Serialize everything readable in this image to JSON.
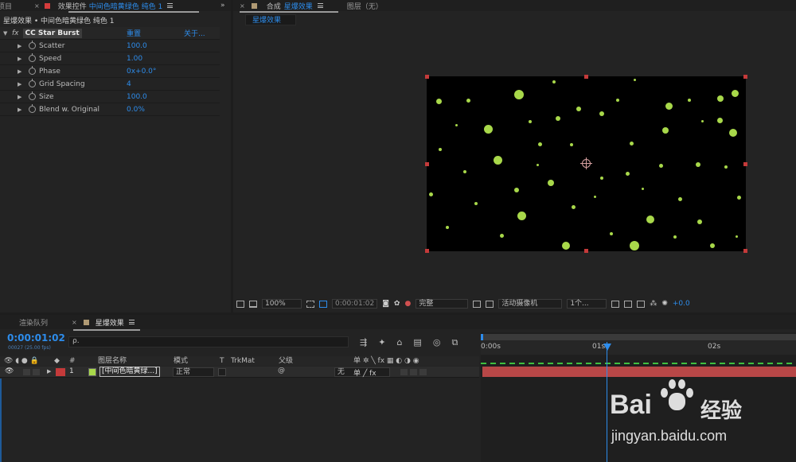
{
  "effect_panel": {
    "tab_project": "项目",
    "tab_prefix": "效果控件",
    "tab_title": "中间色暗黄绿色 纯色 1",
    "path": "星爆效果 • 中间色暗黄绿色 纯色 1",
    "effect_name": "CC Star Burst",
    "reset": "重置",
    "about": "关于...",
    "fx": "fx",
    "props": [
      {
        "name": "Scatter",
        "value": "100.0"
      },
      {
        "name": "Speed",
        "value": "1.00"
      },
      {
        "name": "Phase",
        "value": "0x+0.0°"
      },
      {
        "name": "Grid Spacing",
        "value": "4"
      },
      {
        "name": "Size",
        "value": "100.0"
      },
      {
        "name": "Blend w. Original",
        "value": "0.0%"
      }
    ]
  },
  "comp_panel": {
    "tab_prefix": "合成",
    "tab_name": "星爆效果",
    "layer_tab": "图层（无）",
    "sub_tab": "星爆效果",
    "toolbar": {
      "zoom": "100%",
      "timecode": "0:00:01:02",
      "quality": "完整",
      "camera": "活动摄像机",
      "views": "1个...",
      "exposure": "+0.0"
    }
  },
  "timeline": {
    "tab_render": "渲染队列",
    "tab_name": "星爆效果",
    "timecode": "0:00:01:02",
    "fps": "00027 (25.00 fps)",
    "search_placeholder": "ρ.",
    "col_hash": "#",
    "col_layer": "图层名称",
    "col_mode": "模式",
    "col_t": "T",
    "col_trkmat": "TrkMat",
    "col_parent": "父级",
    "layer": {
      "index": "1",
      "name": "[中间色暗黄绿...]",
      "mode": "正常",
      "parent": "无"
    },
    "ruler": [
      "0:00s",
      "01s",
      "02s"
    ]
  },
  "watermark": {
    "brand": "Bai",
    "brand_cn": "经验",
    "url": "jingyan.baidu.com"
  },
  "colors": {
    "accent": "#2d8ceb",
    "particle": "#a8d84a",
    "layer_label": "#c43a3a",
    "layer_bar": "#b84747"
  }
}
